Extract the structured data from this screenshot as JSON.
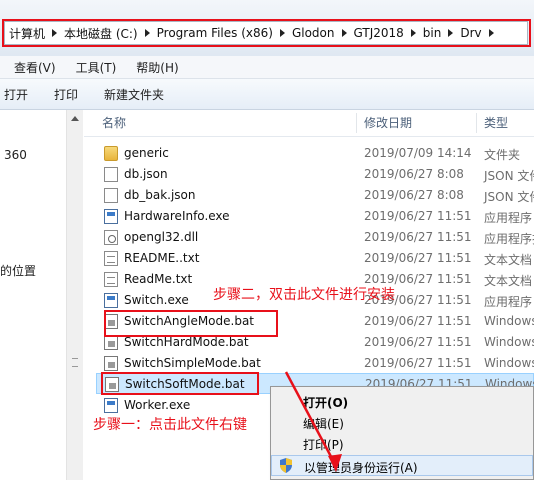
{
  "address": {
    "crumbs": [
      "计算机",
      "本地磁盘 (C:)",
      "Program Files (x86)",
      "Glodon",
      "GTJ2018",
      "bin",
      "Drv"
    ]
  },
  "menubar": [
    "查看(V)",
    "工具(T)",
    "帮助(H)"
  ],
  "toolbar": [
    "打开",
    "打印",
    "新建文件夹"
  ],
  "navpane": [
    "360",
    "的位置"
  ],
  "columns": {
    "name": "名称",
    "date": "修改日期",
    "type": "类型"
  },
  "files": [
    {
      "name": "generic",
      "date": "2019/07/09 14:14",
      "type": "文件夹",
      "icon": "folder-icon"
    },
    {
      "name": "db.json",
      "date": "2019/06/27 8:08",
      "type": "JSON 文件",
      "icon": "file-icon"
    },
    {
      "name": "db_bak.json",
      "date": "2019/06/27 8:08",
      "type": "JSON 文件",
      "icon": "file-icon"
    },
    {
      "name": "HardwareInfo.exe",
      "date": "2019/06/27 11:51",
      "type": "应用程序",
      "icon": "exe-icon"
    },
    {
      "name": "opengl32.dll",
      "date": "2019/06/27 11:51",
      "type": "应用程序扩",
      "icon": "dll-icon"
    },
    {
      "name": "README..txt",
      "date": "2019/06/27 11:51",
      "type": "文本文档",
      "icon": "txt-icon"
    },
    {
      "name": "ReadMe.txt",
      "date": "2019/06/27 11:51",
      "type": "文本文档",
      "icon": "txt-icon"
    },
    {
      "name": "Switch.exe",
      "date": "2019/06/27 11:51",
      "type": "应用程序",
      "icon": "exe-icon"
    },
    {
      "name": "SwitchAngleMode.bat",
      "date": "2019/06/27 11:51",
      "type": "Windows",
      "icon": "bat-icon"
    },
    {
      "name": "SwitchHardMode.bat",
      "date": "2019/06/27 11:51",
      "type": "Windows",
      "icon": "bat-icon"
    },
    {
      "name": "SwitchSimpleMode.bat",
      "date": "2019/06/27 11:51",
      "type": "Windows",
      "icon": "bat-icon"
    },
    {
      "name": "SwitchSoftMode.bat",
      "date": "2019/06/27 11:51",
      "type": "Windows",
      "icon": "bat-icon"
    },
    {
      "name": "Worker.exe",
      "date": "",
      "type": "",
      "icon": "exe-icon"
    }
  ],
  "annotations": {
    "step1": "步骤一：点击此文件右键",
    "step2": "步骤二，双击此文件进行安装"
  },
  "context_menu": [
    "打开(O)",
    "编辑(E)",
    "打印(P)",
    "以管理员身份运行(A)"
  ],
  "colors": {
    "annotation": "#e8101a",
    "selection": "#cce8ff"
  }
}
